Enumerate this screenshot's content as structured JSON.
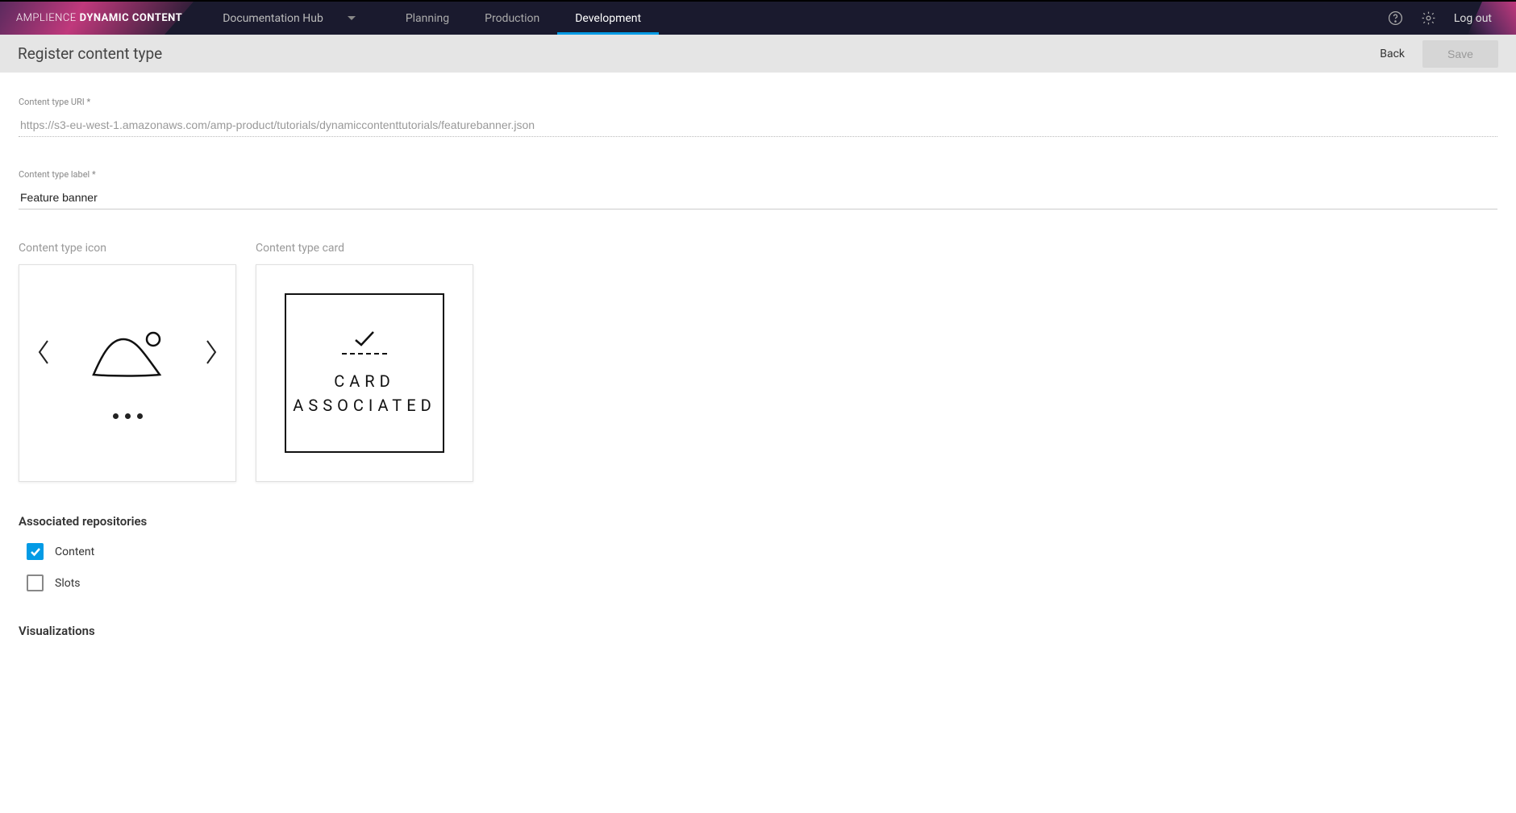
{
  "brand": {
    "light": "AMPLIENCE",
    "bold": "DYNAMIC CONTENT"
  },
  "hub": {
    "name": "Documentation Hub"
  },
  "nav": {
    "tabs": [
      {
        "label": "Planning",
        "active": false
      },
      {
        "label": "Production",
        "active": false
      },
      {
        "label": "Development",
        "active": true
      }
    ]
  },
  "topRight": {
    "logout": "Log out"
  },
  "subheader": {
    "title": "Register content type",
    "back": "Back",
    "save": "Save"
  },
  "form": {
    "uri": {
      "label": "Content type URI *",
      "value": "https://s3-eu-west-1.amazonaws.com/amp-product/tutorials/dynamiccontenttutorials/featurebanner.json"
    },
    "labelField": {
      "label": "Content type label *",
      "value": "Feature banner"
    }
  },
  "cards": {
    "iconLabel": "Content type icon",
    "cardLabel": "Content type card",
    "associated": {
      "line1": "CARD",
      "line2": "ASSOCIATED"
    }
  },
  "repos": {
    "title": "Associated repositories",
    "items": [
      {
        "label": "Content",
        "checked": true
      },
      {
        "label": "Slots",
        "checked": false
      }
    ]
  },
  "visualizations": {
    "title": "Visualizations"
  }
}
